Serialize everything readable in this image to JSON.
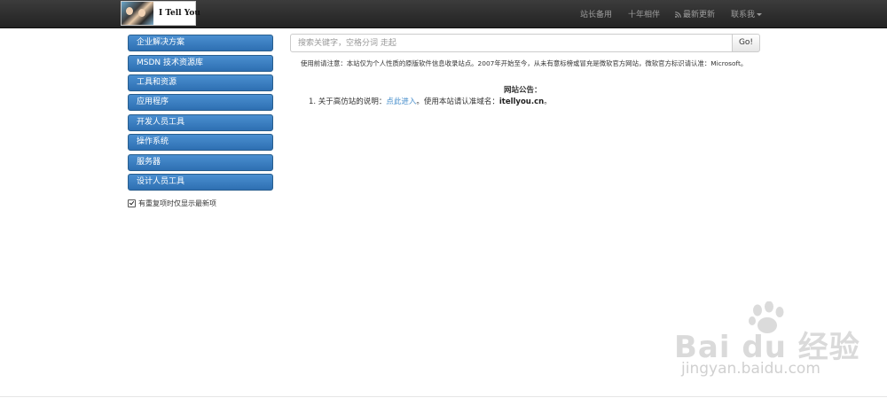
{
  "brand": {
    "text": "I Tell You"
  },
  "nav": {
    "items": [
      {
        "label": "站长备用"
      },
      {
        "label": "十年相伴"
      },
      {
        "label": "最新更新"
      },
      {
        "label": "联系我"
      }
    ]
  },
  "sidebar": {
    "items": [
      {
        "label": "企业解决方案"
      },
      {
        "label": "MSDN 技术资源库"
      },
      {
        "label": "工具和资源"
      },
      {
        "label": "应用程序"
      },
      {
        "label": "开发人员工具"
      },
      {
        "label": "操作系统"
      },
      {
        "label": "服务器"
      },
      {
        "label": "设计人员工具"
      }
    ],
    "checkbox": {
      "label": "有重复项时仅显示最新项",
      "checked": true
    }
  },
  "search": {
    "placeholder": "搜索关键字，空格分词 走起",
    "button_label": "Go!"
  },
  "notice": "使用前请注意：本站仅为个人性质的原版软件信息收录站点。2007年开始至今，从未有意标榜或冒充是微软官方网站，微软官方标识请认准：Microsoft。",
  "announcement": {
    "title": "网站公告：",
    "item_prefix": "1.  关于高仿站的说明：",
    "item_link": "点此进入",
    "item_middle": "。使用本站请认准域名：",
    "item_domain": "itellyou.cn",
    "item_suffix": "。"
  },
  "watermark": {
    "text": "Bai du 经验",
    "sub": "jingyan.baidu.com"
  },
  "colors": {
    "navbar": "#222222",
    "sidebar_button": "#3a7fc3",
    "link": "#428bca"
  }
}
